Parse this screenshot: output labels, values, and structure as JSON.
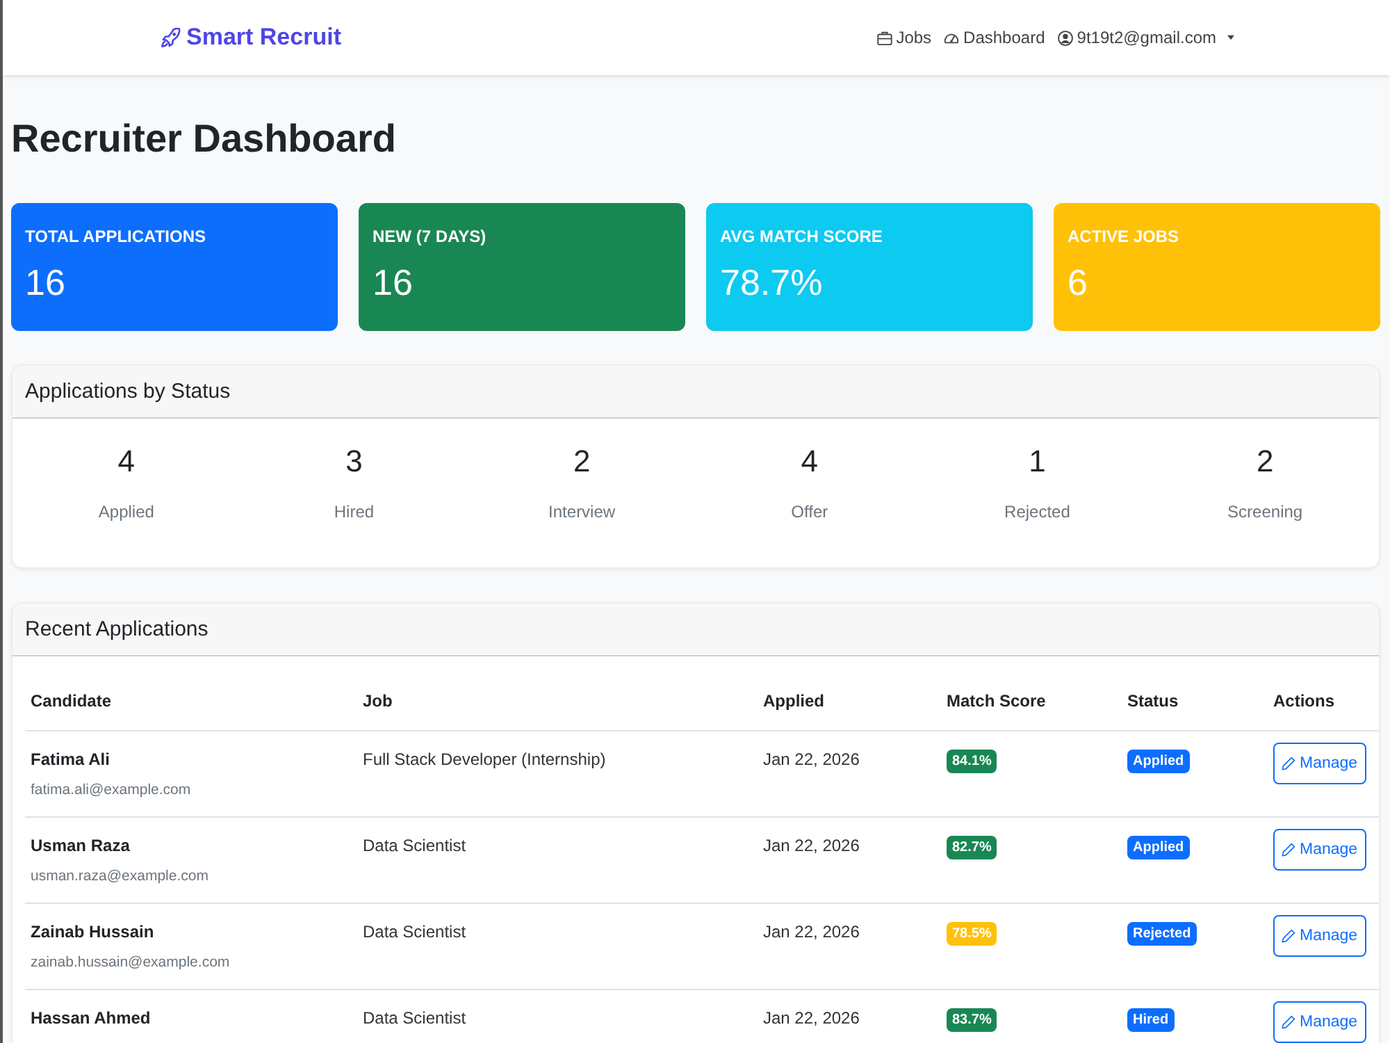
{
  "navbar": {
    "brand": "Smart Recruit",
    "links": [
      {
        "kind": "jobs",
        "label": "Jobs"
      },
      {
        "kind": "dashboard",
        "label": "Dashboard"
      }
    ],
    "user_email": "9t19t2@gmail.com"
  },
  "page_title": "Recruiter Dashboard",
  "stat_cards": [
    {
      "label": "TOTAL APPLICATIONS",
      "value": "16",
      "color": "#0d6efd"
    },
    {
      "label": "NEW (7 DAYS)",
      "value": "16",
      "color": "#198754"
    },
    {
      "label": "AVG MATCH SCORE",
      "value": "78.7%",
      "color": "#0dcaf0"
    },
    {
      "label": "ACTIVE JOBS",
      "value": "6",
      "color": "#ffc107"
    }
  ],
  "status_summary": {
    "title": "Applications by Status",
    "items": [
      {
        "count": "4",
        "label": "Applied"
      },
      {
        "count": "3",
        "label": "Hired"
      },
      {
        "count": "2",
        "label": "Interview"
      },
      {
        "count": "4",
        "label": "Offer"
      },
      {
        "count": "1",
        "label": "Rejected"
      },
      {
        "count": "2",
        "label": "Screening"
      }
    ]
  },
  "recent_applications": {
    "title": "Recent Applications",
    "columns": [
      "Candidate",
      "Job",
      "Applied",
      "Match Score",
      "Status",
      "Actions"
    ],
    "rows": [
      {
        "name": "Fatima Ali",
        "email": "fatima.ali@example.com",
        "job": "Full Stack Developer (Internship)",
        "applied": "Jan 22, 2026",
        "match_score": {
          "text": "84.1%",
          "color": "#198754"
        },
        "status": "Applied",
        "action": "Manage"
      },
      {
        "name": "Usman Raza",
        "email": "usman.raza@example.com",
        "job": "Data Scientist",
        "applied": "Jan 22, 2026",
        "match_score": {
          "text": "82.7%",
          "color": "#198754"
        },
        "status": "Applied",
        "action": "Manage"
      },
      {
        "name": "Zainab Hussain",
        "email": "zainab.hussain@example.com",
        "job": "Data Scientist",
        "applied": "Jan 22, 2026",
        "match_score": {
          "text": "78.5%",
          "color": "#ffc107"
        },
        "status": "Rejected",
        "action": "Manage"
      },
      {
        "name": "Hassan Ahmed",
        "job": "Data Scientist",
        "applied": "Jan 22, 2026",
        "match_score": {
          "text": "83.7%",
          "color": "#198754"
        },
        "status": "Hired",
        "action": "Manage"
      }
    ]
  }
}
